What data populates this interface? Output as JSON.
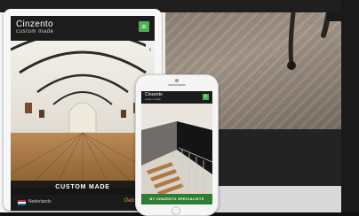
{
  "colors": {
    "accent_green": "#4caf50",
    "banner_dark": "#141414",
    "footer_brand_gold": "#d8a437"
  },
  "tablet": {
    "logo_name": "Cinzento",
    "logo_tagline": "custom made",
    "menu_icon": "menu-icon",
    "side_tab_icon": "chevron-left-icon",
    "banner_label": "CUSTOM MADE",
    "language_label": "Nederlands",
    "footer_brand": "Oeb Bagel"
  },
  "phone": {
    "logo_name": "Cinzento",
    "logo_tagline": "custom made",
    "menu_icon": "menu-icon",
    "caption": "BY CINZENTO SPECIALISTS"
  }
}
